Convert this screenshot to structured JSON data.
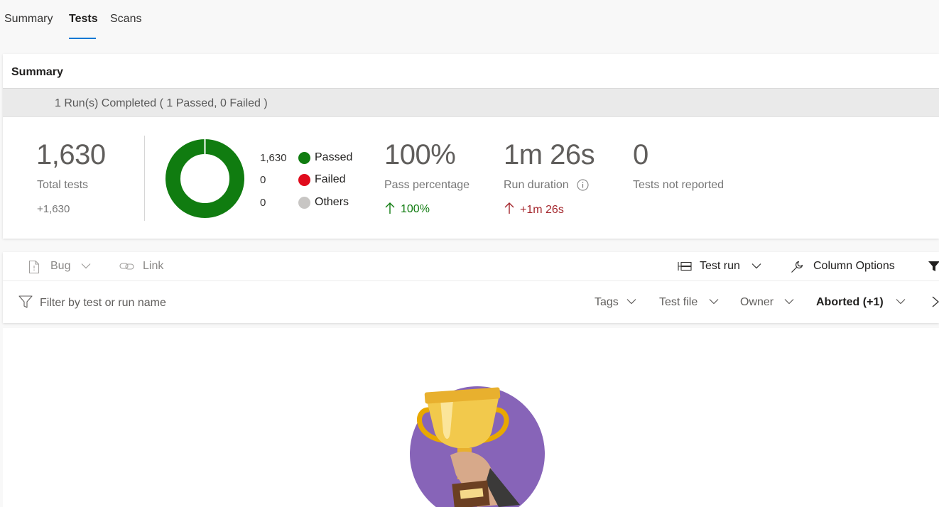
{
  "tabs": [
    {
      "label": "Summary",
      "active": false
    },
    {
      "label": "Tests",
      "active": true
    },
    {
      "label": "Scans",
      "active": false
    }
  ],
  "summary": {
    "title": "Summary",
    "banner": "1 Run(s) Completed ( 1 Passed, 0 Failed )",
    "total": {
      "value": "1,630",
      "label": "Total tests",
      "delta": "+1,630"
    },
    "legend": [
      {
        "count": "1,630",
        "label": "Passed",
        "color": "#107c10"
      },
      {
        "count": "0",
        "label": "Failed",
        "color": "#e00b1c"
      },
      {
        "count": "0",
        "label": "Others",
        "color": "#c8c6c4"
      }
    ],
    "pass_percentage": {
      "value": "100%",
      "label": "Pass percentage",
      "delta": "100%",
      "delta_color": "#107c10"
    },
    "run_duration": {
      "value": "1m 26s",
      "label": "Run duration",
      "delta": "+1m 26s",
      "delta_color": "#a4262c"
    },
    "not_reported": {
      "value": "0",
      "label": "Tests not reported"
    }
  },
  "toolbar": {
    "bug": "Bug",
    "link": "Link",
    "test_run": "Test run",
    "column_options": "Column Options"
  },
  "filters": {
    "placeholder": "Filter by test or run name",
    "tags": "Tags",
    "test_file": "Test file",
    "owner": "Owner",
    "outcome": "Aborted (+1)"
  },
  "colors": {
    "accent": "#0078d4",
    "passed": "#107c10",
    "failed": "#e00b1c",
    "others": "#c8c6c4",
    "trophy_bg": "#8764b8",
    "trophy_gold": "#f2c94c"
  },
  "icons": {
    "bug": "bug-icon",
    "link": "link-icon",
    "test_run": "group-by-icon",
    "column_options": "wrench-icon",
    "filter": "filter-icon",
    "funnel": "funnel-filled-icon",
    "info": "info-icon",
    "empty_state": "trophy-illustration"
  }
}
